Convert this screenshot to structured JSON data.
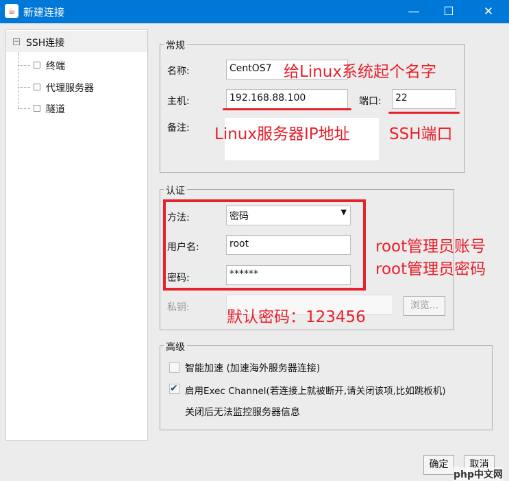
{
  "window": {
    "title": "新建连接",
    "minimize": "—",
    "maximize": "☐",
    "close": "✕"
  },
  "tree": {
    "root": "SSH连接",
    "children": [
      "终端",
      "代理服务器",
      "隧道"
    ]
  },
  "general": {
    "legend": "常规",
    "name_label": "名称:",
    "name_value": "CentOS7",
    "host_label": "主机:",
    "host_value": "192.168.88.100",
    "port_label": "端口:",
    "port_value": "22",
    "note_label": "备注:"
  },
  "auth": {
    "legend": "认证",
    "method_label": "方法:",
    "method_value": "密码",
    "user_label": "用户名:",
    "user_value": "root",
    "pass_label": "密码:",
    "pass_value": "******",
    "key_label": "私钥:",
    "browse": "浏览..."
  },
  "advanced": {
    "legend": "高级",
    "accel_label": "智能加速 (加速海外服务器连接)",
    "accel_checked": false,
    "exec_label": "启用Exec Channel(若连接上就被断开,请关闭该项,比如跳板机)",
    "exec_checked": true,
    "exec_note": "关闭后无法监控服务器信息"
  },
  "buttons": {
    "ok": "确定",
    "cancel": "取消"
  },
  "annotations": {
    "name": "给Linux系统起个名字",
    "host": "Linux服务器IP地址",
    "port": "SSH端口",
    "user": "root管理员账号",
    "pass": "root管理员密码",
    "default_pass": "默认密码：123456"
  },
  "watermark": "php中文网"
}
